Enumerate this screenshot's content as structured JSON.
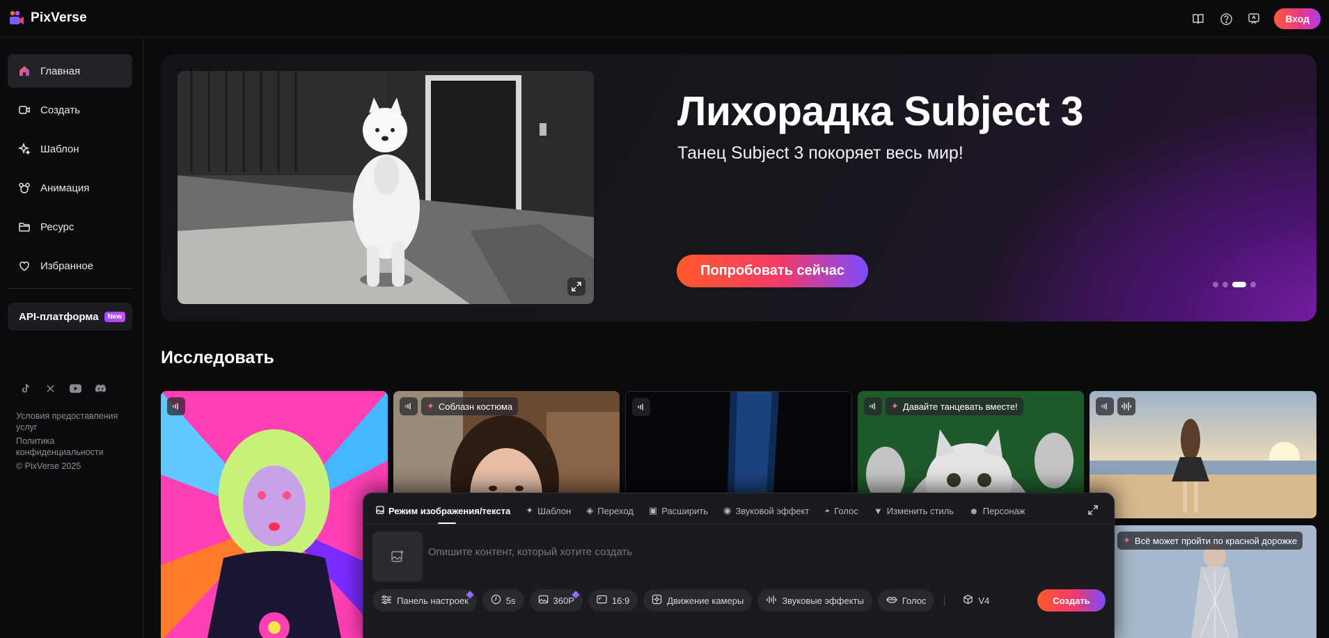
{
  "app": {
    "name": "PixVerse"
  },
  "header": {
    "icons": [
      "book-icon",
      "help-icon",
      "feedback-icon"
    ],
    "login_label": "Вход"
  },
  "sidebar": {
    "items": [
      {
        "label": "Главная",
        "icon": "home-icon",
        "active": true
      },
      {
        "label": "Создать",
        "icon": "video-camera-icon"
      },
      {
        "label": "Шаблон",
        "icon": "sparkle-icon"
      },
      {
        "label": "Анимация",
        "icon": "mouse-ears-icon"
      },
      {
        "label": "Ресурс",
        "icon": "folder-icon"
      },
      {
        "label": "Избранное",
        "icon": "heart-icon"
      }
    ],
    "api": {
      "label": "API-платформа",
      "badge": "New"
    },
    "socials": [
      "tiktok-icon",
      "x-icon",
      "youtube-icon",
      "discord-icon"
    ],
    "legal": {
      "terms": "Условия предоставления услуг",
      "privacy": "Политика конфиденциальности",
      "copyright": "© PixVerse 2025"
    }
  },
  "hero": {
    "title": "Лихорадка Subject 3",
    "subtitle": "Танец Subject 3 покоряет весь мир!",
    "cta": "Попробовать сейчас",
    "slides": 4,
    "active_slide": 3
  },
  "explore": {
    "title": "Исследовать",
    "cards": [
      {
        "label": ""
      },
      {
        "label": "Соблазн костюма"
      },
      {
        "label": ""
      },
      {
        "label": "Давайте танцевать вместе!"
      },
      {
        "label": ""
      },
      {
        "label": "Всё может пройти по красной дорожке"
      }
    ]
  },
  "composer": {
    "tabs": [
      {
        "label": "Режим изображения/текста",
        "active": true
      },
      {
        "label": "Шаблон"
      },
      {
        "label": "Переход"
      },
      {
        "label": "Расширить"
      },
      {
        "label": "Звуковой эффект"
      },
      {
        "label": "Голос"
      },
      {
        "label": "Изменить стиль"
      },
      {
        "label": "Персонаж"
      }
    ],
    "placeholder": "Опишите контент, который хотите создать",
    "toolbar": {
      "settings": "Панель настроек",
      "duration": "5s",
      "quality": "360P",
      "ratio": "16:9",
      "camera": "Движение камеры",
      "sfx": "Звуковые эффекты",
      "voice": "Голос",
      "model": "V4"
    },
    "create_label": "Создать"
  },
  "colors": {
    "accent_start": "#ff5a2b",
    "accent_end": "#7a4cff",
    "bg": "#0b0b0d"
  }
}
